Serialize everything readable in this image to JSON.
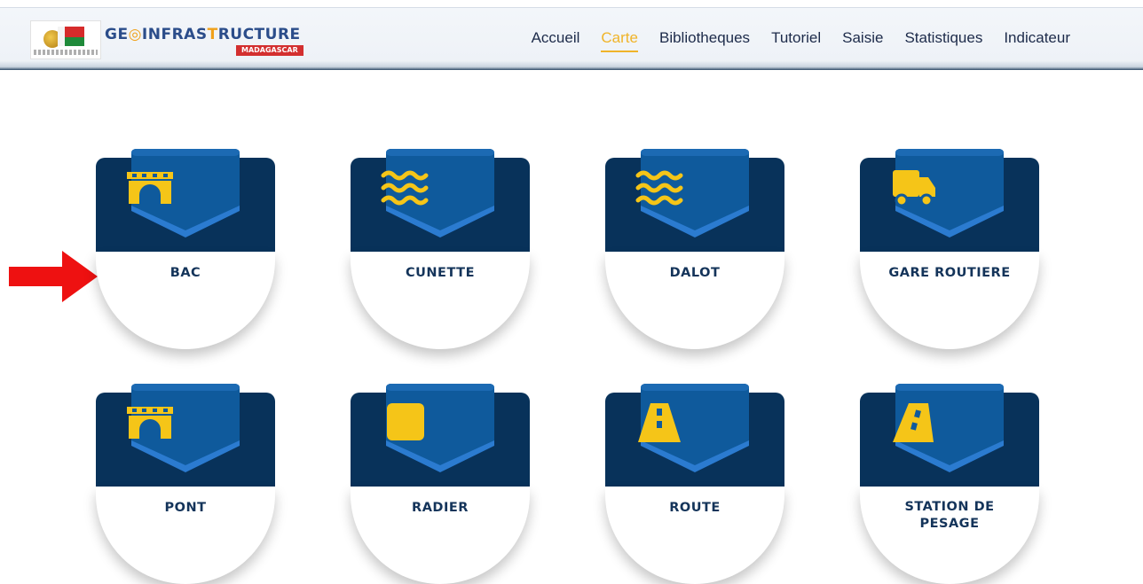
{
  "header": {
    "logo_text_a": "GE",
    "logo_text_b": "◎",
    "logo_text_c": "INFRAS",
    "logo_text_d": "T",
    "logo_text_e": "RUCTURE",
    "logo_sub": "MADAGASCAR",
    "nav": [
      {
        "label": "Accueil",
        "active": false
      },
      {
        "label": "Carte",
        "active": true
      },
      {
        "label": "Bibliotheques",
        "active": false
      },
      {
        "label": "Tutoriel",
        "active": false
      },
      {
        "label": "Saisie",
        "active": false
      },
      {
        "label": "Statistiques",
        "active": false
      },
      {
        "label": "Indicateur",
        "active": false
      }
    ]
  },
  "colors": {
    "card_dark": "#08325a",
    "badge": "#0f5a9c",
    "badge_edge": "#2b7bd0",
    "icon": "#f5c518",
    "nav_active": "#f0b429",
    "arrow": "#ee1111"
  },
  "cards": [
    {
      "label": "BAC",
      "icon": "bridge-icon"
    },
    {
      "label": "CUNETTE",
      "icon": "water-icon"
    },
    {
      "label": "DALOT",
      "icon": "water-icon"
    },
    {
      "label": "GARE ROUTIERE",
      "icon": "truck-icon"
    },
    {
      "label": "PONT",
      "icon": "bridge-icon"
    },
    {
      "label": "RADIER",
      "icon": "square-icon"
    },
    {
      "label": "ROUTE",
      "icon": "road-icon"
    },
    {
      "label": "STATION DE PESAGE",
      "icon": "road-perspective-icon"
    }
  ]
}
